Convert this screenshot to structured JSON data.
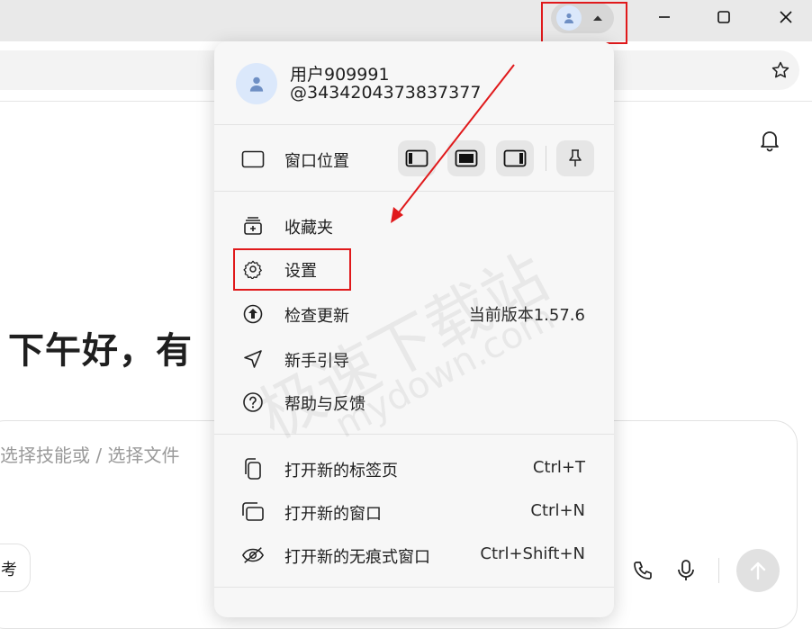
{
  "profile": {
    "name": "用户909991",
    "id": "@3434204373837377"
  },
  "window_position": {
    "label": "窗口位置",
    "options": [
      "dock-left",
      "center",
      "dock-right"
    ],
    "pin_icon": "pin-icon"
  },
  "menu": {
    "items": [
      {
        "label": "收藏夹",
        "icon": "favorites-icon"
      },
      {
        "label": "设置",
        "icon": "gear-icon"
      },
      {
        "label": "检查更新",
        "icon": "update-icon",
        "extra": "当前版本1.57.6"
      },
      {
        "label": "新手引导",
        "icon": "navigation-icon"
      },
      {
        "label": "帮助与反馈",
        "icon": "help-icon"
      }
    ],
    "open_items": [
      {
        "label": "打开新的标签页",
        "shortcut": "Ctrl+T",
        "icon": "new-tab-icon"
      },
      {
        "label": "打开新的窗口",
        "shortcut": "Ctrl+N",
        "icon": "new-window-icon"
      },
      {
        "label": "打开新的无痕式窗口",
        "shortcut": "Ctrl+Shift+N",
        "icon": "incognito-icon"
      }
    ]
  },
  "page": {
    "greeting": "下午好，有",
    "input_placeholder": "选择技能或 / 选择文件",
    "chip_label": "考"
  },
  "watermark": {
    "text": "极速下载站",
    "url": "mydown.com"
  },
  "colors": {
    "highlight": "#e0191b",
    "avatar_bg": "#dbe8fb",
    "avatar_fg": "#6e8fc4"
  }
}
